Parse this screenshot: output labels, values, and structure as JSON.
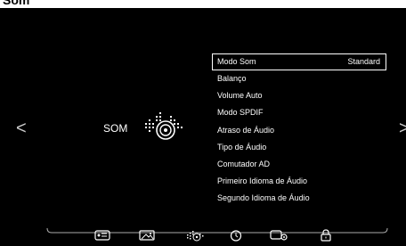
{
  "page": {
    "title": "Som"
  },
  "category": {
    "label": "SOM"
  },
  "menu": {
    "items": [
      {
        "label": "Modo Som",
        "value": "Standard"
      },
      {
        "label": "Balanço"
      },
      {
        "label": "Volume Auto"
      },
      {
        "label": "Modo SPDIF"
      },
      {
        "label": "Atraso de Áudio"
      },
      {
        "label": "Tipo de Áudio"
      },
      {
        "label": "Comutador AD"
      },
      {
        "label": "Primeiro Idioma de Áudio"
      },
      {
        "label": "Segundo Idioma de Áudio"
      }
    ]
  },
  "nav": {
    "left": "<",
    "right": ">"
  },
  "bottom_icons": [
    "picture-icon",
    "image-icon",
    "sound-icon",
    "clock-icon",
    "settings-icon",
    "lock-icon"
  ],
  "colors": {
    "background": "#000000",
    "text": "#ffffff"
  }
}
